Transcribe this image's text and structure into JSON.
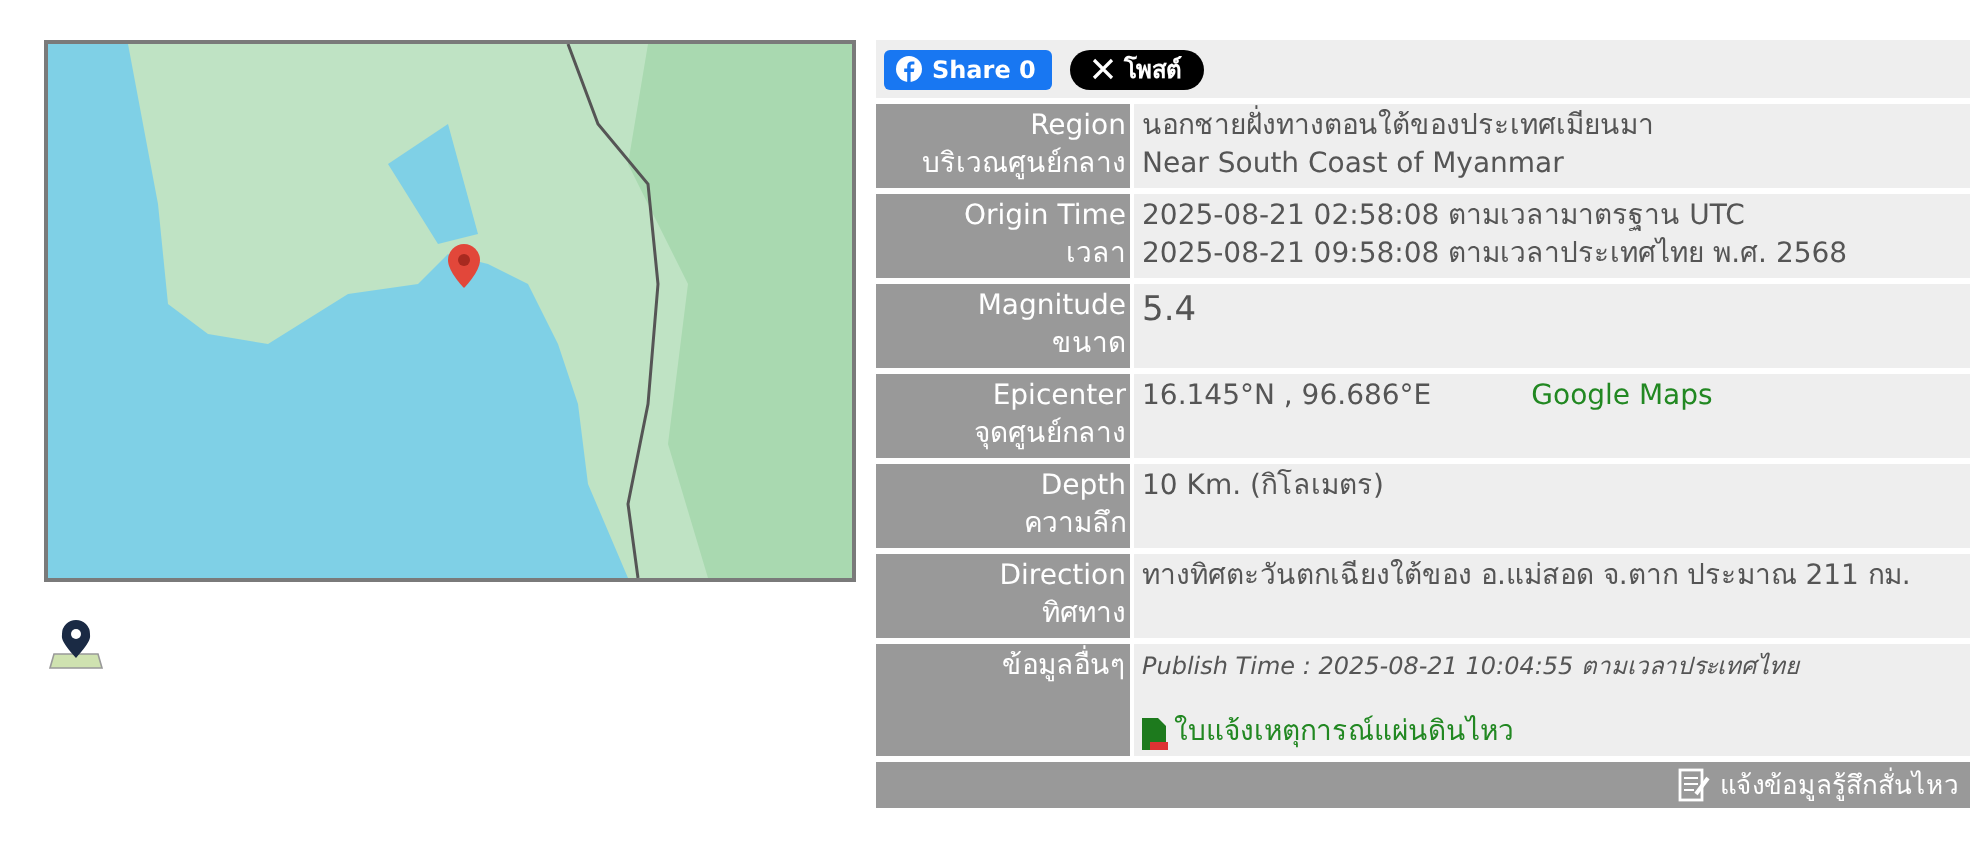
{
  "share": {
    "facebook_label": "Share 0",
    "x_label": "โพสต์"
  },
  "rows": [
    {
      "kind": "text",
      "labels": [
        "Region",
        "บริเวณศูนย์กลาง"
      ],
      "lines": [
        "นอกชายฝั่งทางตอนใต้ของประเทศเมียนมา",
        "Near South Coast of Myanmar"
      ]
    },
    {
      "kind": "text",
      "labels": [
        "Origin Time",
        "เวลา"
      ],
      "lines": [
        "2025-08-21 02:58:08 ตามเวลามาตรฐาน UTC",
        "2025-08-21 09:58:08 ตามเวลาประเทศไทย พ.ศ. 2568"
      ]
    },
    {
      "kind": "large",
      "labels": [
        "Magnitude",
        "ขนาด"
      ],
      "lines": [
        "5.4"
      ]
    },
    {
      "kind": "link",
      "labels": [
        "Epicenter",
        "จุดศูนย์กลาง"
      ],
      "lines": [
        "16.145°N , 96.686°E"
      ],
      "link": "Google Maps"
    },
    {
      "kind": "text",
      "labels": [
        "Depth",
        "ความลึก"
      ],
      "lines": [
        "10 Km. (กิโลเมตร)"
      ]
    },
    {
      "kind": "text",
      "labels": [
        "Direction",
        "ทิศทาง"
      ],
      "lines": [
        "ทางทิศตะวันตกเฉียงใต้ของ อ.แม่สอด จ.ตาก ประมาณ 211 กม."
      ]
    },
    {
      "kind": "publish",
      "labels": [
        "ข้อมูลอื่นๆ"
      ],
      "lines": [
        "Publish Time : 2025-08-21 10:04:55 ตามเวลาประเทศไทย"
      ],
      "link": "ใบแจ้งเหตุการณ์แผ่นดินไหว"
    }
  ],
  "footer": {
    "link": "แจ้งข้อมูลรู้สึกสั่นไหว"
  }
}
